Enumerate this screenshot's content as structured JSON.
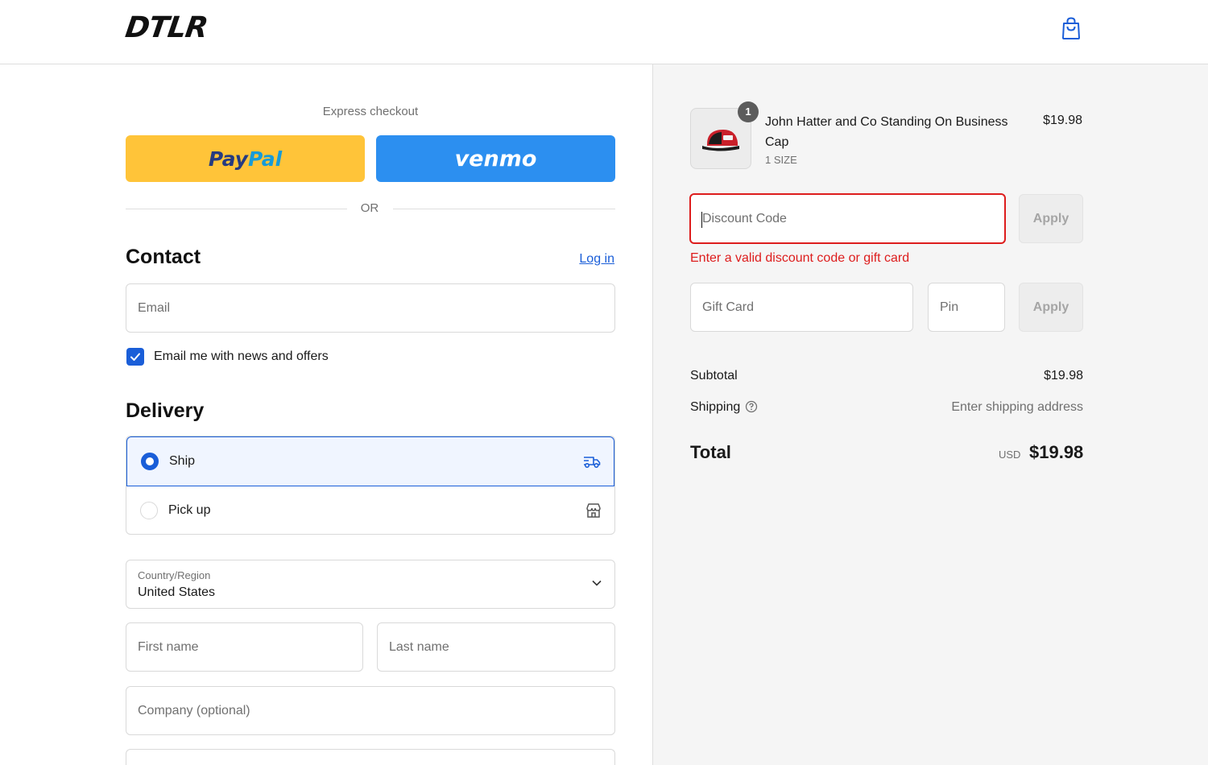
{
  "header": {
    "logo": "DTLR",
    "cart_icon": "shopping-bag-icon"
  },
  "express": {
    "label": "Express checkout",
    "paypal_part1": "Pay",
    "paypal_part2": "Pal",
    "venmo": "venmo",
    "divider": "OR"
  },
  "contact": {
    "heading": "Contact",
    "login_link": "Log in",
    "email_placeholder": "Email",
    "newsletter_label": "Email me with news and offers",
    "newsletter_checked": true
  },
  "delivery": {
    "heading": "Delivery",
    "options": [
      {
        "label": "Ship",
        "selected": true,
        "icon": "truck-icon"
      },
      {
        "label": "Pick up",
        "selected": false,
        "icon": "store-icon"
      }
    ],
    "country_label": "Country/Region",
    "country_value": "United States",
    "first_name_placeholder": "First name",
    "last_name_placeholder": "Last name",
    "company_placeholder": "Company (optional)"
  },
  "summary": {
    "product": {
      "quantity": "1",
      "name": "John Hatter and Co Standing On Business Cap",
      "variant": "1 SIZE",
      "price": "$19.98"
    },
    "discount_placeholder": "Discount Code",
    "apply_label": "Apply",
    "error": "Enter a valid discount code or gift card",
    "gift_card_placeholder": "Gift Card",
    "pin_placeholder": "Pin",
    "subtotal_label": "Subtotal",
    "subtotal_value": "$19.98",
    "shipping_label": "Shipping",
    "shipping_value": "Enter shipping address",
    "total_label": "Total",
    "total_currency": "USD",
    "total_value": "$19.98"
  },
  "colors": {
    "accent": "#1a5ed8",
    "paypal_yellow": "#ffc439",
    "venmo_blue": "#2c8ff0",
    "error_red": "#dd1d1d"
  }
}
